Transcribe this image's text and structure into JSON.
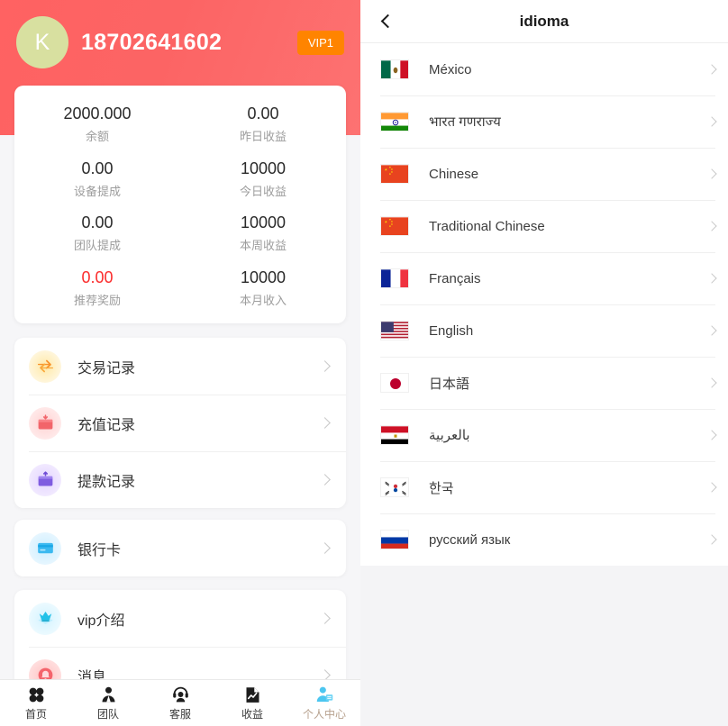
{
  "profile": {
    "avatar_letter": "K",
    "phone": "18702641602",
    "vip_badge": "VIP1",
    "header_color": "#fc6464",
    "vip_badge_color": "#ff8400",
    "avatar_color": "#d8e0a0",
    "stats": [
      {
        "value": "2000.000",
        "label": "余额",
        "accent": false
      },
      {
        "value": "0.00",
        "label": "昨日收益",
        "accent": false
      },
      {
        "value": "0.00",
        "label": "设备提成",
        "accent": false
      },
      {
        "value": "10000",
        "label": "今日收益",
        "accent": false
      },
      {
        "value": "0.00",
        "label": "团队提成",
        "accent": false
      },
      {
        "value": "10000",
        "label": "本周收益",
        "accent": false
      },
      {
        "value": "0.00",
        "label": "推荐奖励",
        "accent": true
      },
      {
        "value": "10000",
        "label": "本月收入",
        "accent": false
      }
    ],
    "menu_group_1": [
      {
        "label": "交易记录",
        "icon": "exchange-arrows-icon"
      },
      {
        "label": "充值记录",
        "icon": "recharge-card-icon"
      },
      {
        "label": "提款记录",
        "icon": "withdraw-card-icon"
      }
    ],
    "menu_group_2": [
      {
        "label": "银行卡",
        "icon": "bank-card-icon"
      }
    ],
    "menu_group_3": [
      {
        "label": "vip介绍",
        "icon": "vip-crown-icon"
      },
      {
        "label": "消息",
        "icon": "message-bell-icon"
      }
    ]
  },
  "bottom_nav": {
    "active_index": 4,
    "active_text_color": "#b6a08d",
    "active_icon_color": "#4cc6f0",
    "items": [
      {
        "label": "首页",
        "icon": "grid-home-icon"
      },
      {
        "label": "团队",
        "icon": "team-person-icon"
      },
      {
        "label": "客服",
        "icon": "headset-support-icon"
      },
      {
        "label": "收益",
        "icon": "chart-earnings-icon"
      },
      {
        "label": "个人中心",
        "icon": "user-profile-icon"
      }
    ]
  },
  "language_page": {
    "title": "idioma",
    "back_icon": "chevron-left-icon",
    "items": [
      {
        "label": "México",
        "flag": "mx-flag-icon"
      },
      {
        "label": "भारत गणराज्य",
        "flag": "in-flag-icon"
      },
      {
        "label": "Chinese",
        "flag": "cn-flag-icon"
      },
      {
        "label": "Traditional Chinese",
        "flag": "cn-flag-icon"
      },
      {
        "label": "Français",
        "flag": "fr-flag-icon"
      },
      {
        "label": "English",
        "flag": "us-flag-icon"
      },
      {
        "label": "日本語",
        "flag": "jp-flag-icon"
      },
      {
        "label": "بالعربية",
        "flag": "eg-flag-icon"
      },
      {
        "label": "한국",
        "flag": "kr-flag-icon"
      },
      {
        "label": "русский язык",
        "flag": "ru-flag-icon"
      }
    ]
  }
}
